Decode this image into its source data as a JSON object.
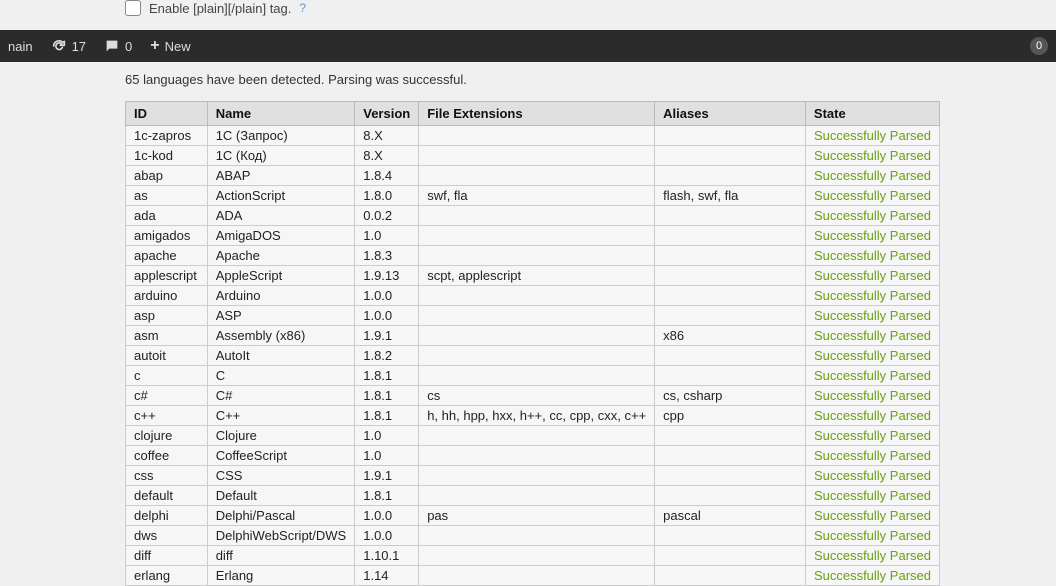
{
  "top": {
    "checkbox_label": "Enable [plain][/plain] tag."
  },
  "toolbar": {
    "left_label": "nain",
    "refresh_count": "17",
    "comment_count": "0",
    "new_label": "New",
    "badge": "0"
  },
  "status": "65 languages have been detected. Parsing was successful.",
  "table": {
    "headers": {
      "id": "ID",
      "name": "Name",
      "version": "Version",
      "ext": "File Extensions",
      "aliases": "Aliases",
      "state": "State"
    },
    "state_label": "Successfully Parsed",
    "rows": [
      {
        "id": "1c-zapros",
        "name": "1C (Запрос)",
        "version": "8.X",
        "ext": "",
        "aliases": ""
      },
      {
        "id": "1c-kod",
        "name": "1C (Код)",
        "version": "8.X",
        "ext": "",
        "aliases": ""
      },
      {
        "id": "abap",
        "name": "ABAP",
        "version": "1.8.4",
        "ext": "",
        "aliases": ""
      },
      {
        "id": "as",
        "name": "ActionScript",
        "version": "1.8.0",
        "ext": "swf, fla",
        "aliases": "flash, swf, fla"
      },
      {
        "id": "ada",
        "name": "ADA",
        "version": "0.0.2",
        "ext": "",
        "aliases": ""
      },
      {
        "id": "amigados",
        "name": "AmigaDOS",
        "version": "1.0",
        "ext": "",
        "aliases": ""
      },
      {
        "id": "apache",
        "name": "Apache",
        "version": "1.8.3",
        "ext": "",
        "aliases": ""
      },
      {
        "id": "applescript",
        "name": "AppleScript",
        "version": "1.9.13",
        "ext": "scpt, applescript",
        "aliases": ""
      },
      {
        "id": "arduino",
        "name": "Arduino",
        "version": "1.0.0",
        "ext": "",
        "aliases": ""
      },
      {
        "id": "asp",
        "name": "ASP",
        "version": "1.0.0",
        "ext": "",
        "aliases": ""
      },
      {
        "id": "asm",
        "name": "Assembly (x86)",
        "version": "1.9.1",
        "ext": "",
        "aliases": "x86"
      },
      {
        "id": "autoit",
        "name": "AutoIt",
        "version": "1.8.2",
        "ext": "",
        "aliases": ""
      },
      {
        "id": "c",
        "name": "C",
        "version": "1.8.1",
        "ext": "",
        "aliases": ""
      },
      {
        "id": "c#",
        "name": "C#",
        "version": "1.8.1",
        "ext": "cs",
        "aliases": "cs, csharp"
      },
      {
        "id": "c++",
        "name": "C++",
        "version": "1.8.1",
        "ext": "h, hh, hpp, hxx, h++, cc, cpp, cxx, c++",
        "aliases": "cpp"
      },
      {
        "id": "clojure",
        "name": "Clojure",
        "version": "1.0",
        "ext": "",
        "aliases": ""
      },
      {
        "id": "coffee",
        "name": "CoffeeScript",
        "version": "1.0",
        "ext": "",
        "aliases": ""
      },
      {
        "id": "css",
        "name": "CSS",
        "version": "1.9.1",
        "ext": "",
        "aliases": ""
      },
      {
        "id": "default",
        "name": "Default",
        "version": "1.8.1",
        "ext": "",
        "aliases": ""
      },
      {
        "id": "delphi",
        "name": "Delphi/Pascal",
        "version": "1.0.0",
        "ext": "pas",
        "aliases": "pascal"
      },
      {
        "id": "dws",
        "name": "DelphiWebScript/DWS",
        "version": "1.0.0",
        "ext": "",
        "aliases": ""
      },
      {
        "id": "diff",
        "name": "diff",
        "version": "1.10.1",
        "ext": "",
        "aliases": ""
      },
      {
        "id": "erlang",
        "name": "Erlang",
        "version": "1.14",
        "ext": "",
        "aliases": ""
      }
    ]
  }
}
